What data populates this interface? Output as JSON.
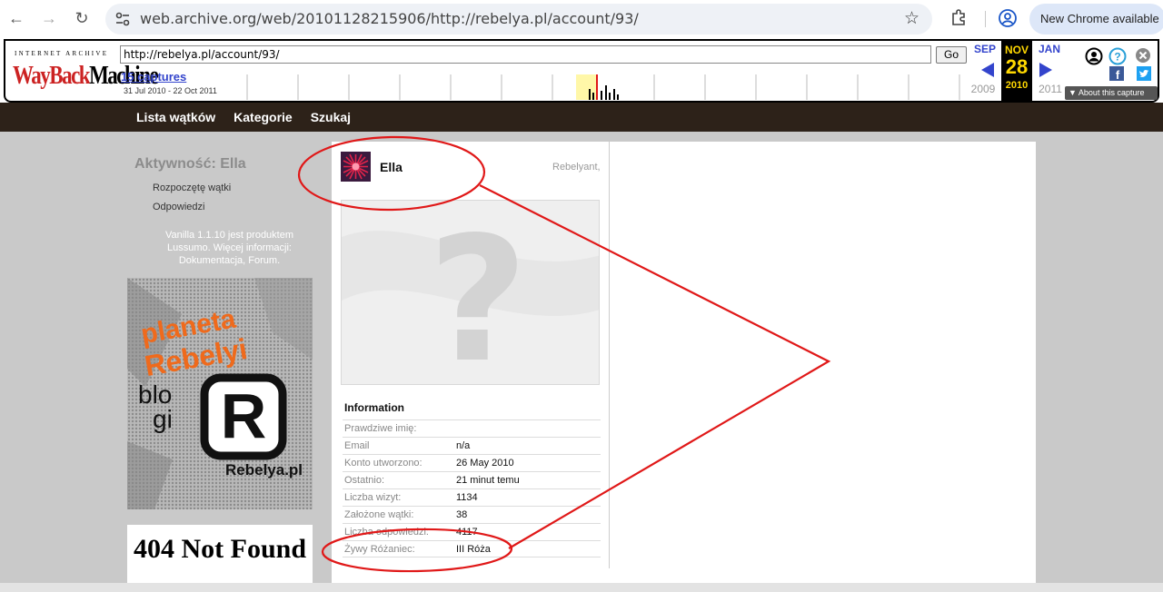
{
  "browser": {
    "url": "web.archive.org/web/20101128215906/http://rebelya.pl/account/93/",
    "update_label": "New Chrome available"
  },
  "wayback": {
    "logo_top": "INTERNET ARCHIVE",
    "logo_main": "WaybackMachine",
    "url_input": "http://rebelya.pl/account/93/",
    "go_label": "Go",
    "captures": "15 captures",
    "range": "31 Jul 2010 - 22 Oct 2011",
    "prev_month": "SEP",
    "cur_month": "NOV",
    "next_month": "JAN",
    "prev_year": "2009",
    "cur_day": "28",
    "cur_year": "2010",
    "next_year": "2011",
    "about_label": "About this capture"
  },
  "site": {
    "nav": [
      "Lista wątków",
      "Kategorie",
      "Szukaj"
    ]
  },
  "sidebar": {
    "title": "Aktywność: Ella",
    "links": [
      "Rozpoczętę wątki",
      "Odpowiedzi"
    ],
    "note": "Vanilla 1.1.10 jest produktem Lussumo. Więcej informacji: Dokumentacja, Forum.",
    "banner_lines": [
      "planeta",
      "Rebelyi",
      "blo",
      "gi",
      "Rebelya.pl"
    ],
    "notfound": "404 Not Found"
  },
  "profile": {
    "name": "Ella",
    "role": "Rebelyant,",
    "info_title": "Information",
    "rows": [
      {
        "k": "Prawdziwe imię:",
        "v": ""
      },
      {
        "k": "Email",
        "v": "n/a"
      },
      {
        "k": "Konto utworzono:",
        "v": "26 May 2010"
      },
      {
        "k": "Ostatnio:",
        "v": "21 minut temu"
      },
      {
        "k": "Liczba wizyt:",
        "v": "1134"
      },
      {
        "k": "Założone wątki:",
        "v": "38"
      },
      {
        "k": "Liczba odpowiedzi:",
        "v": "4117"
      },
      {
        "k": "Żywy Różaniec:",
        "v": "III Róża"
      }
    ]
  },
  "colors": {
    "site_header": "#2d2219",
    "page_bg": "#c9c9c9",
    "annotation": "#e01818",
    "wayback_blue": "#3344cc",
    "wayback_gold": "#ffd800"
  }
}
